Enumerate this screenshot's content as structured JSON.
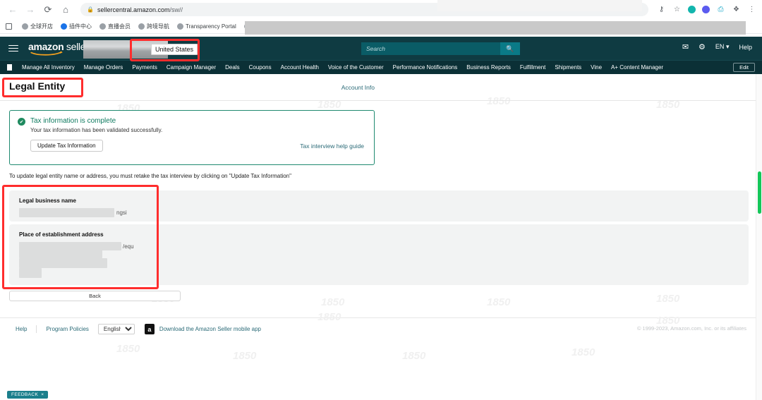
{
  "browser": {
    "url_host": "sellercentral.amazon.com",
    "url_path": "/sw//",
    "back_icon": "←",
    "forward_icon": "→",
    "reload_icon": "⟳",
    "home_icon": "⌂",
    "lock_icon": "ὑ2",
    "toolbar_icons": [
      "key-icon",
      "star-icon",
      "profile-circle-icon",
      "extension-circle-icon",
      "gift-icon",
      "puzzle-icon",
      "kebab-menu-icon"
    ],
    "bookmarks": [
      {
        "label": "",
        "icon": "share-icon"
      },
      {
        "label": "全球开店",
        "icon": "globe-icon"
      },
      {
        "label": "插件中心",
        "icon": "globe-icon-blue"
      },
      {
        "label": "直播会员",
        "icon": "globe-icon"
      },
      {
        "label": "跨境导航",
        "icon": "globe-icon"
      },
      {
        "label": "Transparency Portal",
        "icon": "globe-icon"
      },
      {
        "label": "B",
        "icon": "globe-icon"
      }
    ]
  },
  "header": {
    "logo_brand": "amazon",
    "logo_suffix": " seller central",
    "country": "United States",
    "search_placeholder": "Search",
    "search_value": "",
    "mail_icon": "✉",
    "gear_icon": "⚙",
    "language": "EN",
    "language_caret": "▾",
    "help": "Help"
  },
  "nav": {
    "items": [
      "Manage All Inventory",
      "Manage Orders",
      "Payments",
      "Campaign Manager",
      "Deals",
      "Coupons",
      "Account Health",
      "Voice of the Customer",
      "Performance Notifications",
      "Business Reports",
      "Fulfillment",
      "Shipments",
      "Vine",
      "A+ Content Manager"
    ],
    "edit_label": "Edit"
  },
  "main": {
    "page_title": "Legal Entity",
    "account_info_link": "Account Info",
    "success": {
      "check_icon": "✔",
      "title": "Tax information is complete",
      "subtitle": "Your tax information has been validated successfully.",
      "update_button": "Update Tax Information",
      "help_guide_link": "Tax interview help guide"
    },
    "instructions": "To update legal entity name or address, you must retake the tax interview by clicking on \"Update Tax Information\"",
    "fields": [
      {
        "label": "Legal business name",
        "value_visible": "ngsi",
        "redacted": true
      },
      {
        "label": "Place of establishment address",
        "value_visible": "/equ",
        "redacted": true
      }
    ],
    "back_button": "Back"
  },
  "footer": {
    "help": "Help",
    "program_policies": "Program Policies",
    "language_selected": "English",
    "language_options": [
      "English"
    ],
    "app_icon_letter": "a",
    "app_link": "Download the Amazon Seller mobile app",
    "copyright": "© 1999-2023, Amazon.com, Inc. or its affiliates"
  },
  "feedback": {
    "label": "FEEDBACK",
    "close_icon": "×"
  },
  "watermarks": [
    "1850",
    "1850",
    "1850",
    "1850",
    "1850",
    "1850",
    "1850",
    "1850",
    "1850",
    "1850",
    "1850",
    "1850",
    "1850",
    "1850",
    "1850",
    "1850",
    "1850",
    "1850"
  ],
  "colors": {
    "header_bg": "#0f3b42",
    "nav_bg": "#0b3036",
    "search_btn": "#0a7a87",
    "success_border": "#1f8a70",
    "success_title": "#0e7a5f",
    "link": "#2a6a77",
    "annotation_red": "#ff2d2d",
    "scrollbar_thumb": "#14c759",
    "feedback_bg": "#1b7f8c"
  }
}
